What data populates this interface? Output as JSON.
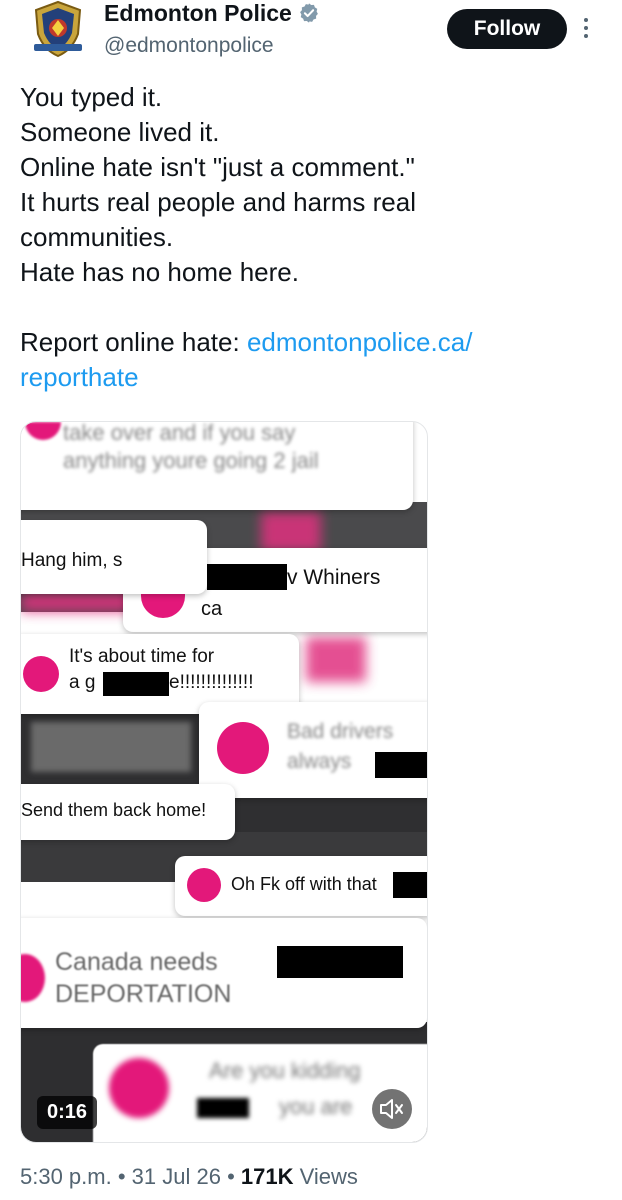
{
  "author": {
    "display_name": "Edmonton Police",
    "handle": "@edmontonpolice",
    "verified": true,
    "follow_label": "Follow"
  },
  "icons": {
    "verified": "verified-badge-icon",
    "more": "more-options-icon",
    "mute": "volume-muted-icon"
  },
  "tweet": {
    "lines": [
      "You typed it.",
      "Someone lived it.",
      "Online hate isn't \"just a comment.\"",
      "It hurts real people and harms real",
      "communities.",
      "Hate has no home here."
    ],
    "report_prefix": "Report online hate: ",
    "link_part1": "edmontonpolice.ca/",
    "link_part2": "reporthate"
  },
  "video": {
    "duration": "0:16",
    "comments": {
      "c1_line1": "take over and if you say",
      "c1_line2": "anything youre going 2 jail",
      "c2": "Hang him, s",
      "c3_suffix": "v Whiners",
      "c3_line2": "ca",
      "c4_line1": "It's about time for",
      "c4_line2_start": "a g",
      "c4_line2_end": "e!!!!!!!!!!!!!!",
      "c5_line1": "Bad drivers",
      "c5_line2": "always",
      "c6": "Send them back home!",
      "c7": "Oh Fk off with that",
      "c8_line1": "Canada needs",
      "c8_line2": "DEPORTATION",
      "c9_line1": "Are you kidding",
      "c9_line2": "you are"
    }
  },
  "footer": {
    "time": "5:30 p.m.",
    "sep": " • ",
    "date": "31 Jul 26",
    "views_count": "171K",
    "views_label": " Views"
  },
  "colors": {
    "accent_link": "#1d9bf0",
    "verified": "#829aab",
    "pink": "#e3187a"
  }
}
